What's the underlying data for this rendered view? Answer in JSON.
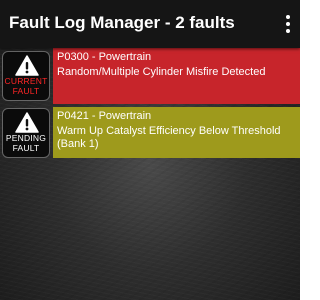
{
  "app": {
    "title": "Fault Log Manager - 2 faults",
    "menu_icon": "overflow-menu-icon"
  },
  "faults": [
    {
      "code_line": "P0300 - Powertrain",
      "description": "Random/Multiple Cylinder Misfire Detected",
      "status_label_line1": "CURRENT",
      "status_label_line2": "FAULT",
      "icon": "warning-triangle-icon",
      "color": "#c7252b"
    },
    {
      "code_line": "P0421 - Powertrain",
      "description": "Warm Up Catalyst Efficiency Below Threshold (Bank 1)",
      "status_label_line1": "PENDING",
      "status_label_line2": "FAULT",
      "icon": "warning-triangle-icon",
      "color": "#9e9a1c"
    }
  ]
}
